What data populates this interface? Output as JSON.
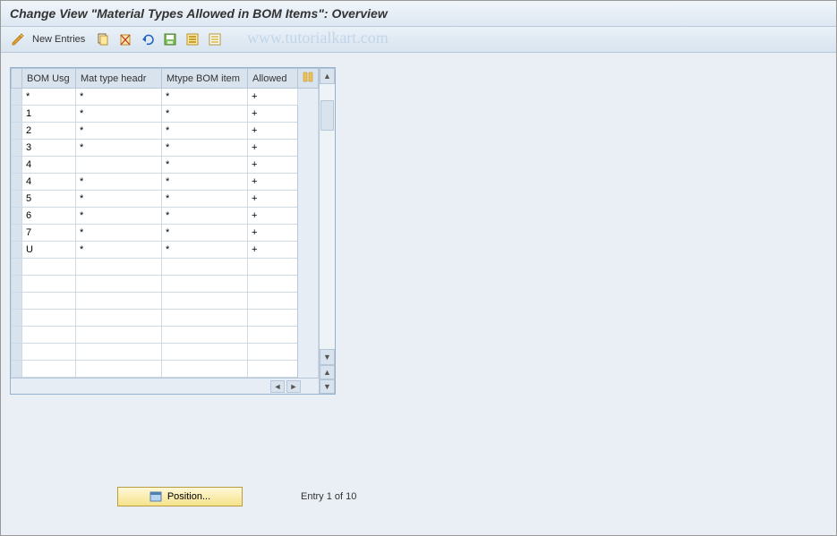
{
  "header": {
    "title": "Change View \"Material Types Allowed in BOM Items\": Overview"
  },
  "toolbar": {
    "new_entries": "New Entries"
  },
  "watermark": "www.tutorialkart.com",
  "grid": {
    "columns": {
      "bom_usg": "BOM Usg",
      "mat_type_headr": "Mat type headr",
      "mtype_bom_item": "Mtype BOM item",
      "allowed": "Allowed"
    },
    "rows": [
      {
        "bom_usg": "*",
        "mat_type_headr": "*",
        "mtype_bom_item": "*",
        "allowed": "+"
      },
      {
        "bom_usg": "1",
        "mat_type_headr": "*",
        "mtype_bom_item": "*",
        "allowed": "+"
      },
      {
        "bom_usg": "2",
        "mat_type_headr": "*",
        "mtype_bom_item": "*",
        "allowed": "+"
      },
      {
        "bom_usg": "3",
        "mat_type_headr": "*",
        "mtype_bom_item": "*",
        "allowed": "+"
      },
      {
        "bom_usg": "4",
        "mat_type_headr": "",
        "mtype_bom_item": "*",
        "allowed": "+"
      },
      {
        "bom_usg": "4",
        "mat_type_headr": "*",
        "mtype_bom_item": "*",
        "allowed": "+"
      },
      {
        "bom_usg": "5",
        "mat_type_headr": "*",
        "mtype_bom_item": "*",
        "allowed": "+"
      },
      {
        "bom_usg": "6",
        "mat_type_headr": "*",
        "mtype_bom_item": "*",
        "allowed": "+"
      },
      {
        "bom_usg": "7",
        "mat_type_headr": "*",
        "mtype_bom_item": "*",
        "allowed": "+"
      },
      {
        "bom_usg": "U",
        "mat_type_headr": "*",
        "mtype_bom_item": "*",
        "allowed": "+"
      }
    ],
    "empty_rows": 7
  },
  "footer": {
    "position_label": "Position...",
    "entry_text": "Entry 1 of 10"
  }
}
